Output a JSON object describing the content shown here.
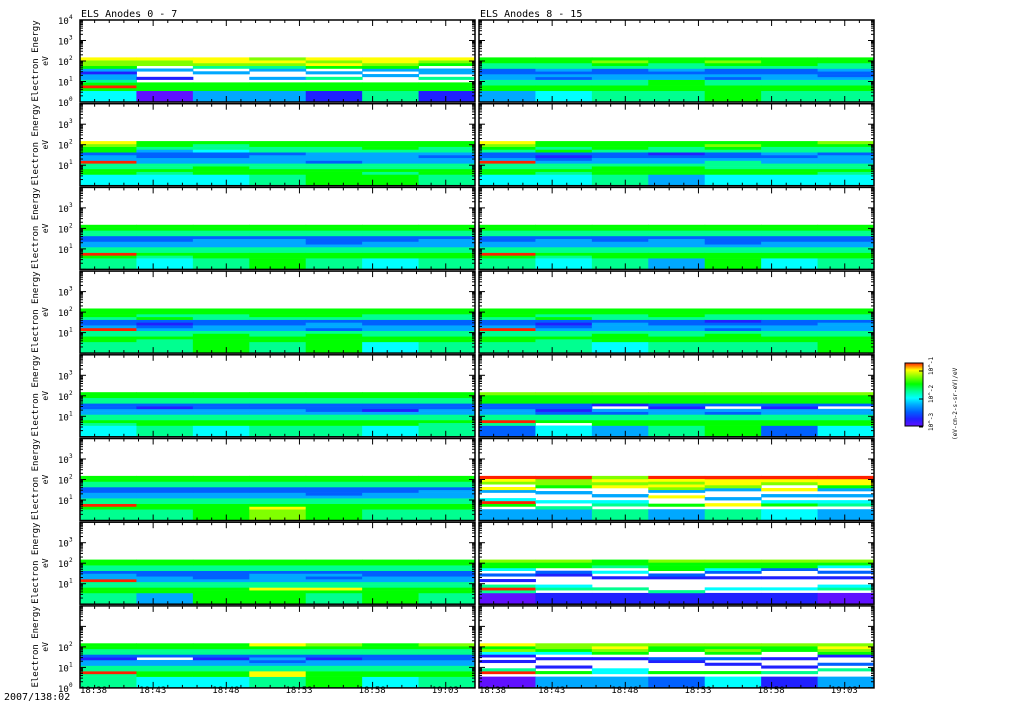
{
  "chart_data": {
    "type": "heatmap",
    "titles": [
      "ELS Anodes 0 - 7",
      "ELS Anodes 8 - 15"
    ],
    "ylabel": "Electron Energy",
    "yunits": "eV",
    "yscale": "log",
    "ylim": [
      1,
      10000
    ],
    "ytick_labels": [
      "10",
      "10",
      "10",
      "10",
      "10"
    ],
    "ytick_exponents": [
      "0",
      "1",
      "2",
      "3",
      "4"
    ],
    "x_start_label": "2007/138:02",
    "xtick_labels": [
      "18:38",
      "18:43",
      "18:48",
      "18:53",
      "18:58",
      "19:03"
    ],
    "xlim_minutes": [
      0,
      27
    ],
    "time_bins": 7,
    "energy_range_of_data_eV": [
      1,
      150
    ],
    "colorbar": {
      "label": "(eV-cm-2-s-sr-eV)/eV",
      "tick_labels": [
        "10",
        "10",
        "10"
      ],
      "tick_exponents": [
        "-1",
        "-2",
        "-3"
      ],
      "colors": [
        "#6010ff",
        "#2020ff",
        "#0060ff",
        "#00a8ff",
        "#00ffff",
        "#00ff90",
        "#00ff00",
        "#80ff00",
        "#ffff00",
        "#ff2000"
      ]
    },
    "value_encoding": "each column string lists color levels 0-9 from lowest to highest energy bin; '.' = no data",
    "panels": [
      {
        "col": 0,
        "row": 0,
        "columns": [
          "4696533136778",
          "0666.1..3.778",
          "3666...3.5788",
          "3666.3..35787",
          "1666.5.3.6878",
          "5666..3.36788",
          "1666.5.33.678"
        ]
      },
      {
        "col": 1,
        "row": 0,
        "columns": [
          "3665533225566",
          "4665523235566",
          "5665533225676",
          "5666633235566",
          "6665523225676",
          "5665533225666",
          "5665532235566"
        ]
      },
      {
        "col": 0,
        "row": 1,
        "columns": [
          "4665593326678",
          "4565533223566",
          "4666533224556",
          "5665533325566",
          "6665523335566",
          "6565533335666",
          "5665533235566"
        ]
      },
      {
        "col": 1,
        "row": 1,
        "columns": [
          "4665593225678",
          "4565532126566",
          "5666533225666",
          "3666533215566",
          "4665553225676",
          "4665533235566",
          "4565533325567"
        ]
      },
      {
        "col": 0,
        "row": 2,
        "columns": [
          "5695533225566",
          "4565533225566",
          "5665533325566",
          "6665533325566",
          "5665532225566",
          "4665533225566",
          "5665533325566"
        ]
      },
      {
        "col": 1,
        "row": 2,
        "columns": [
          "5695533225566",
          "4565533325566",
          "5665533225566",
          "3665533325566",
          "6665532225566",
          "4665533225566",
          "5665533225566"
        ]
      },
      {
        "col": 0,
        "row": 3,
        "columns": [
          "5665593225666",
          "5565532126566",
          "6666533225566",
          "5665533225666",
          "6666523325666",
          "4665533225566",
          "5665533225566"
        ]
      },
      {
        "col": 1,
        "row": 3,
        "columns": [
          "5665593225666",
          "5565532126566",
          "4666533325566",
          "5665533225666",
          "5666523215566",
          "5665533225566",
          "6665533325566"
        ]
      },
      {
        "col": 0,
        "row": 4,
        "columns": [
          "4565533225566",
          "5665533125566",
          "4665533225566",
          "5665533225566",
          "5665532225566",
          "4665531225566",
          "5565533225566"
        ]
      },
      {
        "col": 1,
        "row": 4,
        "columns": [
          "2595533226667",
          "4.65521226667",
          "3665523.16667",
          "5665533126667",
          "6665523.26667",
          "2665533126667",
          "4665533.26667"
        ]
      },
      {
        "col": 0,
        "row": 5,
        "columns": [
          "5695533225566",
          "5665533225566",
          "6665533225566",
          "7865533225566",
          "6665532225566",
          "5665533225566",
          "5665533325566"
        ]
      },
      {
        "col": 1,
        "row": 5,
        "columns": [
          "3.694..38.789",
          "35.4..3.6779",
          "5.54.3..8787",
          "3.6..8.378789",
          "5.8.3..37889",
          "4.64.3.8.789",
          "3.54.3.36889"
        ]
      },
      {
        "col": 0,
        "row": 6,
        "columns": [
          "5665593325566",
          "3665533225566",
          "6665532225566",
          "6685533325566",
          "5685532325566",
          "6665533225566",
          "5665533225566"
        ]
      },
      {
        "col": 1,
        "row": 6,
        "columns": [
          "0595.1.2.4667",
          "1.54...12.667",
          "1.5...1.4.566",
          "15....12.6667",
          "1.4...1.24667",
          "1.4...1..2667",
          "0.54..1.2.467"
        ]
      },
      {
        "col": 0,
        "row": 7,
        "columns": [
          "5595533125566",
          "4665533.25566",
          "4665533125566",
          "5885532325568",
          "6665533125567",
          "4665533225566",
          "5665533225567"
        ]
      },
      {
        "col": 1,
        "row": 7,
        "columns": [
          "0.95..1.14768",
          "3.6.1..1.4677",
          "3.44...1.6787",
          "2.6...12..667",
          "4.6..1.2.6767",
          "1.5.1..1..667",
          "3..5.2..16787"
        ]
      }
    ]
  }
}
